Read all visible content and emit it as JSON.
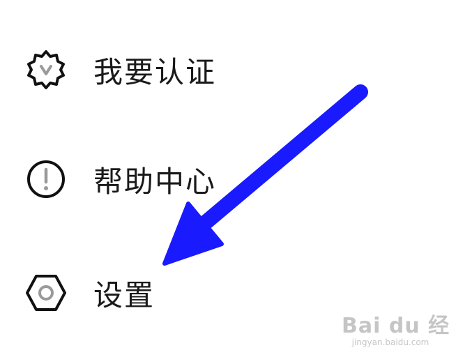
{
  "menu": {
    "items": [
      {
        "label": "我要认证",
        "icon": "verified-badge-icon"
      },
      {
        "label": "帮助中心",
        "icon": "exclamation-circle-icon"
      },
      {
        "label": "设置",
        "icon": "hexagon-gear-icon"
      }
    ]
  },
  "annotation": {
    "arrow_color": "#1a1aff",
    "points_to": "设置"
  },
  "watermark": {
    "logo": "Bai du 经验",
    "url": "jingyan.baidu.com"
  },
  "colors": {
    "background": "#ffffff",
    "text": "#1a1a1a",
    "icon_stroke": "#111111",
    "icon_inner": "#9a9a9a",
    "arrow": "#1a1aff"
  }
}
